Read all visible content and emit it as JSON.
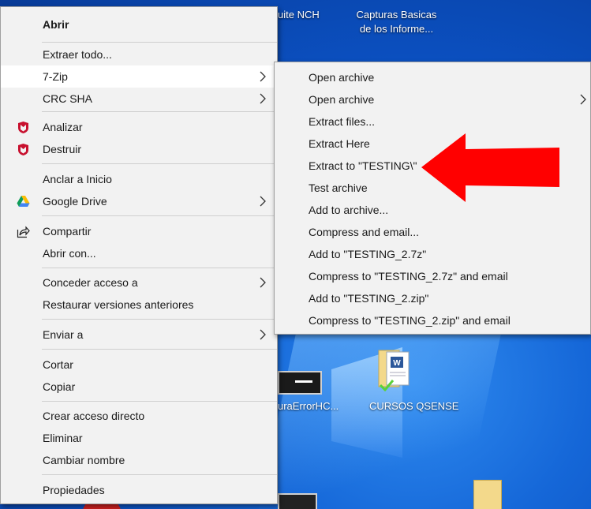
{
  "desktop": {
    "labels": [
      {
        "id": "suite",
        "text": "uite NCH"
      },
      {
        "id": "capturas",
        "line1": "Capturas Basicas",
        "line2": "de los Informe..."
      },
      {
        "id": "rrorhc",
        "text": "uraErrorHC..."
      },
      {
        "id": "cursos",
        "text": "CURSOS QSENSE"
      }
    ]
  },
  "main_menu": {
    "items": [
      {
        "label": "Abrir"
      },
      {
        "label": "Extraer todo..."
      },
      {
        "label": "7-Zip"
      },
      {
        "label": "CRC SHA"
      },
      {
        "label": "Analizar"
      },
      {
        "label": "Destruir"
      },
      {
        "label": "Anclar a Inicio"
      },
      {
        "label": "Google Drive"
      },
      {
        "label": "Compartir"
      },
      {
        "label": "Abrir con..."
      },
      {
        "label": "Conceder acceso a"
      },
      {
        "label": "Restaurar versiones anteriores"
      },
      {
        "label": "Enviar a"
      },
      {
        "label": "Cortar"
      },
      {
        "label": "Copiar"
      },
      {
        "label": "Crear acceso directo"
      },
      {
        "label": "Eliminar"
      },
      {
        "label": "Cambiar nombre"
      },
      {
        "label": "Propiedades"
      }
    ]
  },
  "sub_menu": {
    "items": [
      {
        "label": "Open archive"
      },
      {
        "label": "Open archive"
      },
      {
        "label": "Extract files..."
      },
      {
        "label": "Extract Here"
      },
      {
        "label": "Extract to \"TESTING\\\""
      },
      {
        "label": "Test archive"
      },
      {
        "label": "Add to archive..."
      },
      {
        "label": "Compress and email..."
      },
      {
        "label": "Add to \"TESTING_2.7z\""
      },
      {
        "label": "Compress to \"TESTING_2.7z\" and email"
      },
      {
        "label": "Add to \"TESTING_2.zip\""
      },
      {
        "label": "Compress to \"TESTING_2.zip\" and email"
      }
    ]
  },
  "colors": {
    "menu_bg": "#f2f2f2",
    "highlight": "#ffffff",
    "arrow": "#ff0000",
    "mcafee": "#c8102e",
    "desktop": "#0b4fbf"
  }
}
